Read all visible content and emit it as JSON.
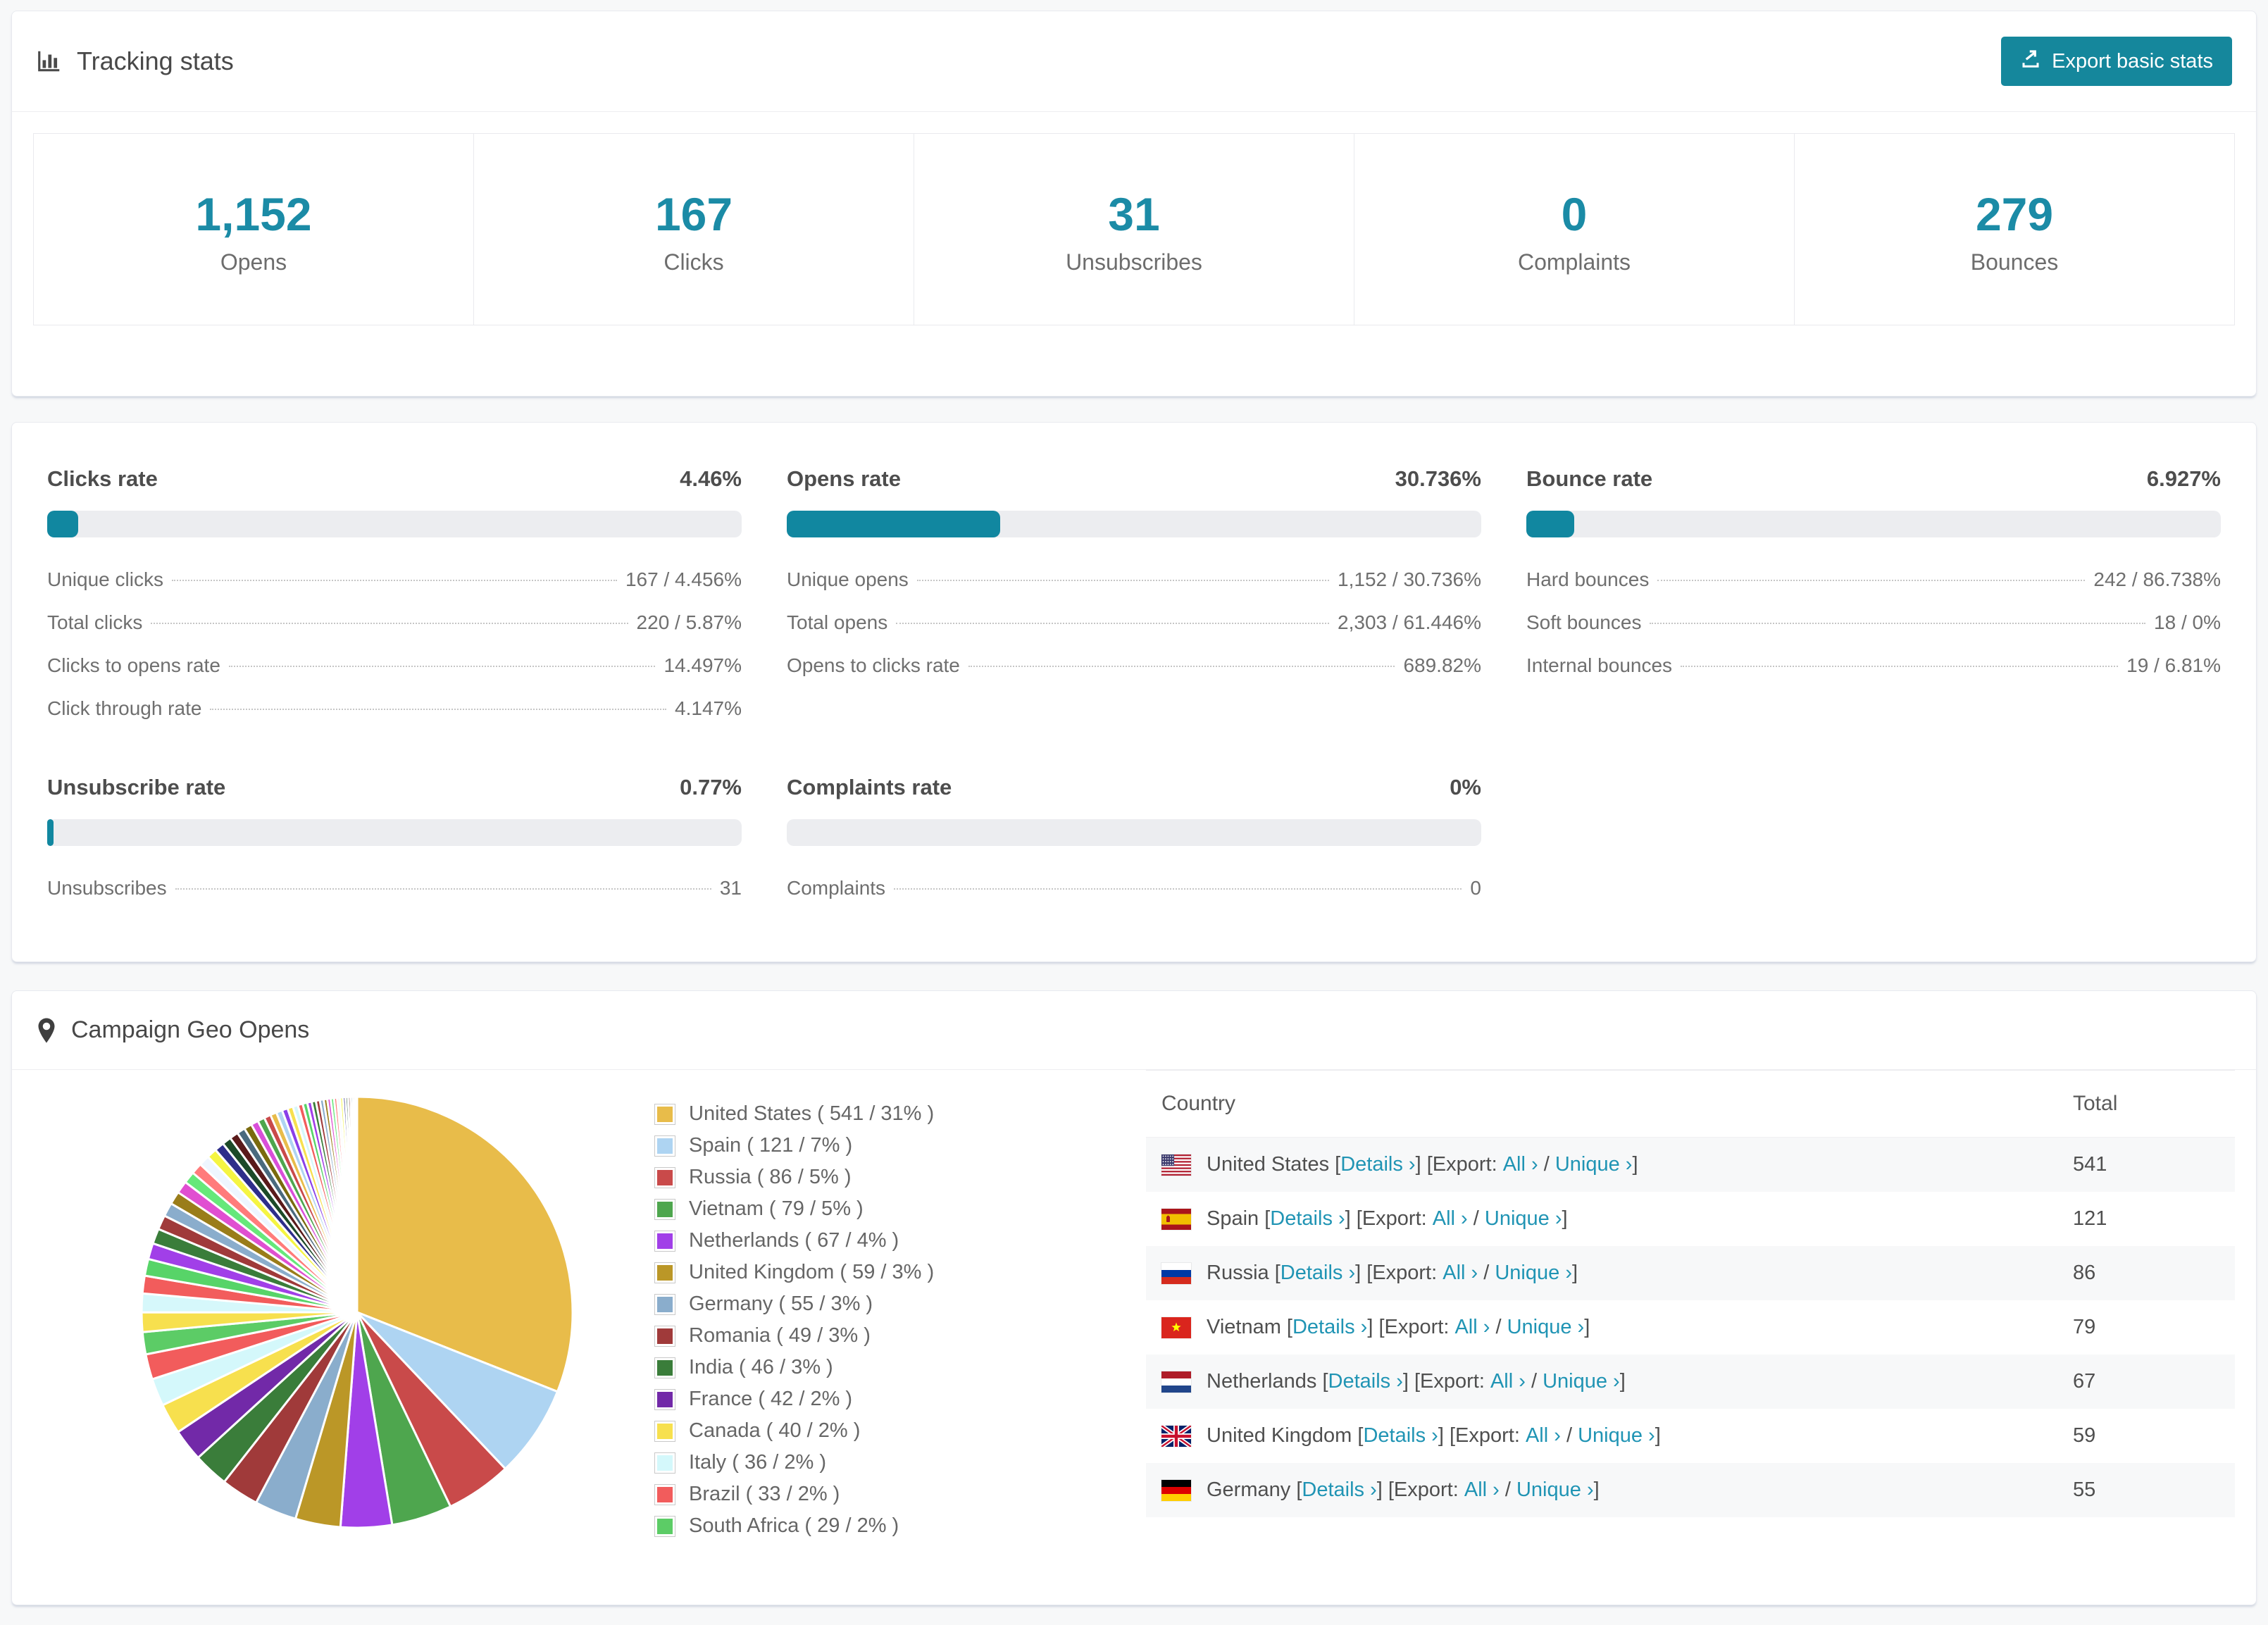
{
  "accent": "#1b8ba6",
  "tracking": {
    "title": "Tracking stats",
    "export_label": "Export basic stats",
    "stats": [
      {
        "value": "1,152",
        "label": "Opens"
      },
      {
        "value": "167",
        "label": "Clicks"
      },
      {
        "value": "31",
        "label": "Unsubscribes"
      },
      {
        "value": "0",
        "label": "Complaints"
      },
      {
        "value": "279",
        "label": "Bounces"
      }
    ]
  },
  "rates": {
    "panels": [
      {
        "title": "Clicks rate",
        "value": "4.46%",
        "percent": 4.46,
        "rows": [
          {
            "label": "Unique clicks",
            "value": "167 / 4.456%"
          },
          {
            "label": "Total clicks",
            "value": "220 / 5.87%"
          },
          {
            "label": "Clicks to opens rate",
            "value": "14.497%"
          },
          {
            "label": "Click through rate",
            "value": "4.147%"
          }
        ]
      },
      {
        "title": "Opens rate",
        "value": "30.736%",
        "percent": 30.736,
        "rows": [
          {
            "label": "Unique opens",
            "value": "1,152 / 30.736%"
          },
          {
            "label": "Total opens",
            "value": "2,303 / 61.446%"
          },
          {
            "label": "Opens to clicks rate",
            "value": "689.82%"
          }
        ]
      },
      {
        "title": "Bounce rate",
        "value": "6.927%",
        "percent": 6.927,
        "rows": [
          {
            "label": "Hard bounces",
            "value": "242 / 86.738%"
          },
          {
            "label": "Soft bounces",
            "value": "18 / 0%"
          },
          {
            "label": "Internal bounces",
            "value": "19 / 6.81%"
          }
        ]
      },
      {
        "title": "Unsubscribe rate",
        "value": "0.77%",
        "percent": 0.77,
        "rows": [
          {
            "label": "Unsubscribes",
            "value": "31"
          }
        ]
      },
      {
        "title": "Complaints rate",
        "value": "0%",
        "percent": 0,
        "rows": [
          {
            "label": "Complaints",
            "value": "0"
          }
        ]
      }
    ]
  },
  "geo": {
    "title": "Campaign Geo Opens",
    "table": {
      "headers": [
        "Country",
        "Total"
      ],
      "links": {
        "details": "Details ›",
        "export_prefix": "Export:",
        "all": "All ›",
        "unique": "Unique ›"
      },
      "rows": [
        {
          "country": "United States",
          "flag": "us",
          "total": "541"
        },
        {
          "country": "Spain",
          "flag": "es",
          "total": "121"
        },
        {
          "country": "Russia",
          "flag": "ru",
          "total": "86"
        },
        {
          "country": "Vietnam",
          "flag": "vn",
          "total": "79"
        },
        {
          "country": "Netherlands",
          "flag": "nl",
          "total": "67"
        },
        {
          "country": "United Kingdom",
          "flag": "gb",
          "total": "59"
        },
        {
          "country": "Germany",
          "flag": "de",
          "total": "55"
        }
      ]
    }
  },
  "chart_data": {
    "type": "pie",
    "title": "Campaign Geo Opens",
    "legend_position": "right",
    "series": [
      {
        "name": "United States",
        "value": 541,
        "pct": 31,
        "color": "#e8bc4a"
      },
      {
        "name": "Spain",
        "value": 121,
        "pct": 7,
        "color": "#aed4f2"
      },
      {
        "name": "Russia",
        "value": 86,
        "pct": 5,
        "color": "#c94a4a"
      },
      {
        "name": "Vietnam",
        "value": 79,
        "pct": 5,
        "color": "#4ea64e"
      },
      {
        "name": "Netherlands",
        "value": 67,
        "pct": 4,
        "color": "#a13fe8"
      },
      {
        "name": "United Kingdom",
        "value": 59,
        "pct": 3,
        "color": "#bb9727"
      },
      {
        "name": "Germany",
        "value": 55,
        "pct": 3,
        "color": "#8aadcc"
      },
      {
        "name": "Romania",
        "value": 49,
        "pct": 3,
        "color": "#a03a3a"
      },
      {
        "name": "India",
        "value": 46,
        "pct": 3,
        "color": "#3a7d3a"
      },
      {
        "name": "France",
        "value": 42,
        "pct": 2,
        "color": "#7229a8"
      },
      {
        "name": "Canada",
        "value": 40,
        "pct": 2,
        "color": "#f7e04e"
      },
      {
        "name": "Italy",
        "value": 36,
        "pct": 2,
        "color": "#d4f8fb"
      },
      {
        "name": "Brazil",
        "value": 33,
        "pct": 2,
        "color": "#f25c5c"
      },
      {
        "name": "South Africa",
        "value": 29,
        "pct": 2,
        "color": "#5ccc66"
      }
    ],
    "other_unlabeled_total": 462,
    "tail_palette": [
      "#f7e04e",
      "#d6f8fb",
      "#f25c5c",
      "#57d468",
      "#a13fe8",
      "#3a7d3a",
      "#a03a3a",
      "#8aadcc",
      "#9a7d1a",
      "#e04fd1",
      "#66e87a",
      "#ff7b7b",
      "#eef6ff",
      "#f5f542",
      "#2e2e8a",
      "#1c4a28",
      "#5a1a1a",
      "#4a6a7e",
      "#7a6a0e",
      "#d94fd9",
      "#4ea64e",
      "#c94a4a",
      "#e8bc4a",
      "#aed4f2",
      "#8a3fe8"
    ]
  }
}
